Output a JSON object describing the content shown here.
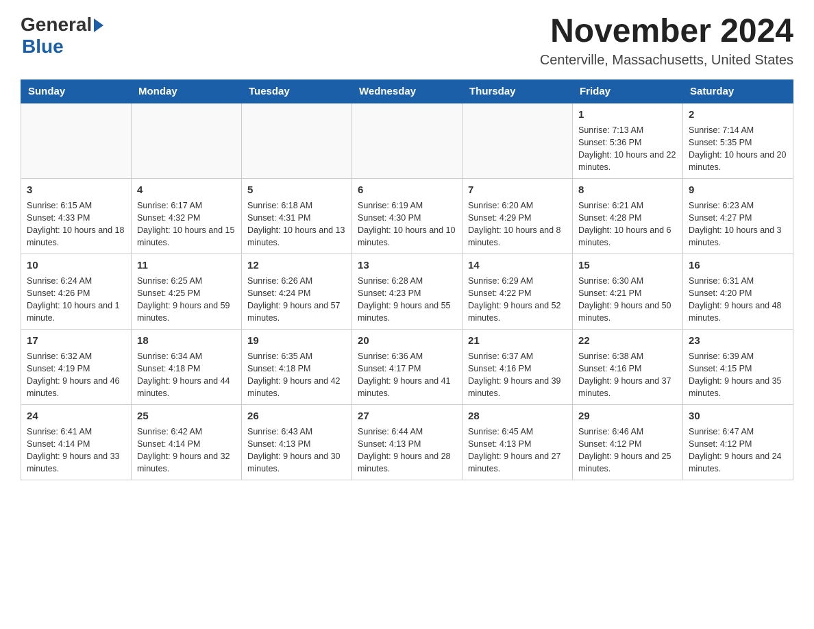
{
  "logo": {
    "general": "General",
    "blue": "Blue"
  },
  "header": {
    "title": "November 2024",
    "subtitle": "Centerville, Massachusetts, United States"
  },
  "weekdays": [
    "Sunday",
    "Monday",
    "Tuesday",
    "Wednesday",
    "Thursday",
    "Friday",
    "Saturday"
  ],
  "weeks": [
    [
      {
        "day": "",
        "sunrise": "",
        "sunset": "",
        "daylight": ""
      },
      {
        "day": "",
        "sunrise": "",
        "sunset": "",
        "daylight": ""
      },
      {
        "day": "",
        "sunrise": "",
        "sunset": "",
        "daylight": ""
      },
      {
        "day": "",
        "sunrise": "",
        "sunset": "",
        "daylight": ""
      },
      {
        "day": "",
        "sunrise": "",
        "sunset": "",
        "daylight": ""
      },
      {
        "day": "1",
        "sunrise": "Sunrise: 7:13 AM",
        "sunset": "Sunset: 5:36 PM",
        "daylight": "Daylight: 10 hours and 22 minutes."
      },
      {
        "day": "2",
        "sunrise": "Sunrise: 7:14 AM",
        "sunset": "Sunset: 5:35 PM",
        "daylight": "Daylight: 10 hours and 20 minutes."
      }
    ],
    [
      {
        "day": "3",
        "sunrise": "Sunrise: 6:15 AM",
        "sunset": "Sunset: 4:33 PM",
        "daylight": "Daylight: 10 hours and 18 minutes."
      },
      {
        "day": "4",
        "sunrise": "Sunrise: 6:17 AM",
        "sunset": "Sunset: 4:32 PM",
        "daylight": "Daylight: 10 hours and 15 minutes."
      },
      {
        "day": "5",
        "sunrise": "Sunrise: 6:18 AM",
        "sunset": "Sunset: 4:31 PM",
        "daylight": "Daylight: 10 hours and 13 minutes."
      },
      {
        "day": "6",
        "sunrise": "Sunrise: 6:19 AM",
        "sunset": "Sunset: 4:30 PM",
        "daylight": "Daylight: 10 hours and 10 minutes."
      },
      {
        "day": "7",
        "sunrise": "Sunrise: 6:20 AM",
        "sunset": "Sunset: 4:29 PM",
        "daylight": "Daylight: 10 hours and 8 minutes."
      },
      {
        "day": "8",
        "sunrise": "Sunrise: 6:21 AM",
        "sunset": "Sunset: 4:28 PM",
        "daylight": "Daylight: 10 hours and 6 minutes."
      },
      {
        "day": "9",
        "sunrise": "Sunrise: 6:23 AM",
        "sunset": "Sunset: 4:27 PM",
        "daylight": "Daylight: 10 hours and 3 minutes."
      }
    ],
    [
      {
        "day": "10",
        "sunrise": "Sunrise: 6:24 AM",
        "sunset": "Sunset: 4:26 PM",
        "daylight": "Daylight: 10 hours and 1 minute."
      },
      {
        "day": "11",
        "sunrise": "Sunrise: 6:25 AM",
        "sunset": "Sunset: 4:25 PM",
        "daylight": "Daylight: 9 hours and 59 minutes."
      },
      {
        "day": "12",
        "sunrise": "Sunrise: 6:26 AM",
        "sunset": "Sunset: 4:24 PM",
        "daylight": "Daylight: 9 hours and 57 minutes."
      },
      {
        "day": "13",
        "sunrise": "Sunrise: 6:28 AM",
        "sunset": "Sunset: 4:23 PM",
        "daylight": "Daylight: 9 hours and 55 minutes."
      },
      {
        "day": "14",
        "sunrise": "Sunrise: 6:29 AM",
        "sunset": "Sunset: 4:22 PM",
        "daylight": "Daylight: 9 hours and 52 minutes."
      },
      {
        "day": "15",
        "sunrise": "Sunrise: 6:30 AM",
        "sunset": "Sunset: 4:21 PM",
        "daylight": "Daylight: 9 hours and 50 minutes."
      },
      {
        "day": "16",
        "sunrise": "Sunrise: 6:31 AM",
        "sunset": "Sunset: 4:20 PM",
        "daylight": "Daylight: 9 hours and 48 minutes."
      }
    ],
    [
      {
        "day": "17",
        "sunrise": "Sunrise: 6:32 AM",
        "sunset": "Sunset: 4:19 PM",
        "daylight": "Daylight: 9 hours and 46 minutes."
      },
      {
        "day": "18",
        "sunrise": "Sunrise: 6:34 AM",
        "sunset": "Sunset: 4:18 PM",
        "daylight": "Daylight: 9 hours and 44 minutes."
      },
      {
        "day": "19",
        "sunrise": "Sunrise: 6:35 AM",
        "sunset": "Sunset: 4:18 PM",
        "daylight": "Daylight: 9 hours and 42 minutes."
      },
      {
        "day": "20",
        "sunrise": "Sunrise: 6:36 AM",
        "sunset": "Sunset: 4:17 PM",
        "daylight": "Daylight: 9 hours and 41 minutes."
      },
      {
        "day": "21",
        "sunrise": "Sunrise: 6:37 AM",
        "sunset": "Sunset: 4:16 PM",
        "daylight": "Daylight: 9 hours and 39 minutes."
      },
      {
        "day": "22",
        "sunrise": "Sunrise: 6:38 AM",
        "sunset": "Sunset: 4:16 PM",
        "daylight": "Daylight: 9 hours and 37 minutes."
      },
      {
        "day": "23",
        "sunrise": "Sunrise: 6:39 AM",
        "sunset": "Sunset: 4:15 PM",
        "daylight": "Daylight: 9 hours and 35 minutes."
      }
    ],
    [
      {
        "day": "24",
        "sunrise": "Sunrise: 6:41 AM",
        "sunset": "Sunset: 4:14 PM",
        "daylight": "Daylight: 9 hours and 33 minutes."
      },
      {
        "day": "25",
        "sunrise": "Sunrise: 6:42 AM",
        "sunset": "Sunset: 4:14 PM",
        "daylight": "Daylight: 9 hours and 32 minutes."
      },
      {
        "day": "26",
        "sunrise": "Sunrise: 6:43 AM",
        "sunset": "Sunset: 4:13 PM",
        "daylight": "Daylight: 9 hours and 30 minutes."
      },
      {
        "day": "27",
        "sunrise": "Sunrise: 6:44 AM",
        "sunset": "Sunset: 4:13 PM",
        "daylight": "Daylight: 9 hours and 28 minutes."
      },
      {
        "day": "28",
        "sunrise": "Sunrise: 6:45 AM",
        "sunset": "Sunset: 4:13 PM",
        "daylight": "Daylight: 9 hours and 27 minutes."
      },
      {
        "day": "29",
        "sunrise": "Sunrise: 6:46 AM",
        "sunset": "Sunset: 4:12 PM",
        "daylight": "Daylight: 9 hours and 25 minutes."
      },
      {
        "day": "30",
        "sunrise": "Sunrise: 6:47 AM",
        "sunset": "Sunset: 4:12 PM",
        "daylight": "Daylight: 9 hours and 24 minutes."
      }
    ]
  ]
}
